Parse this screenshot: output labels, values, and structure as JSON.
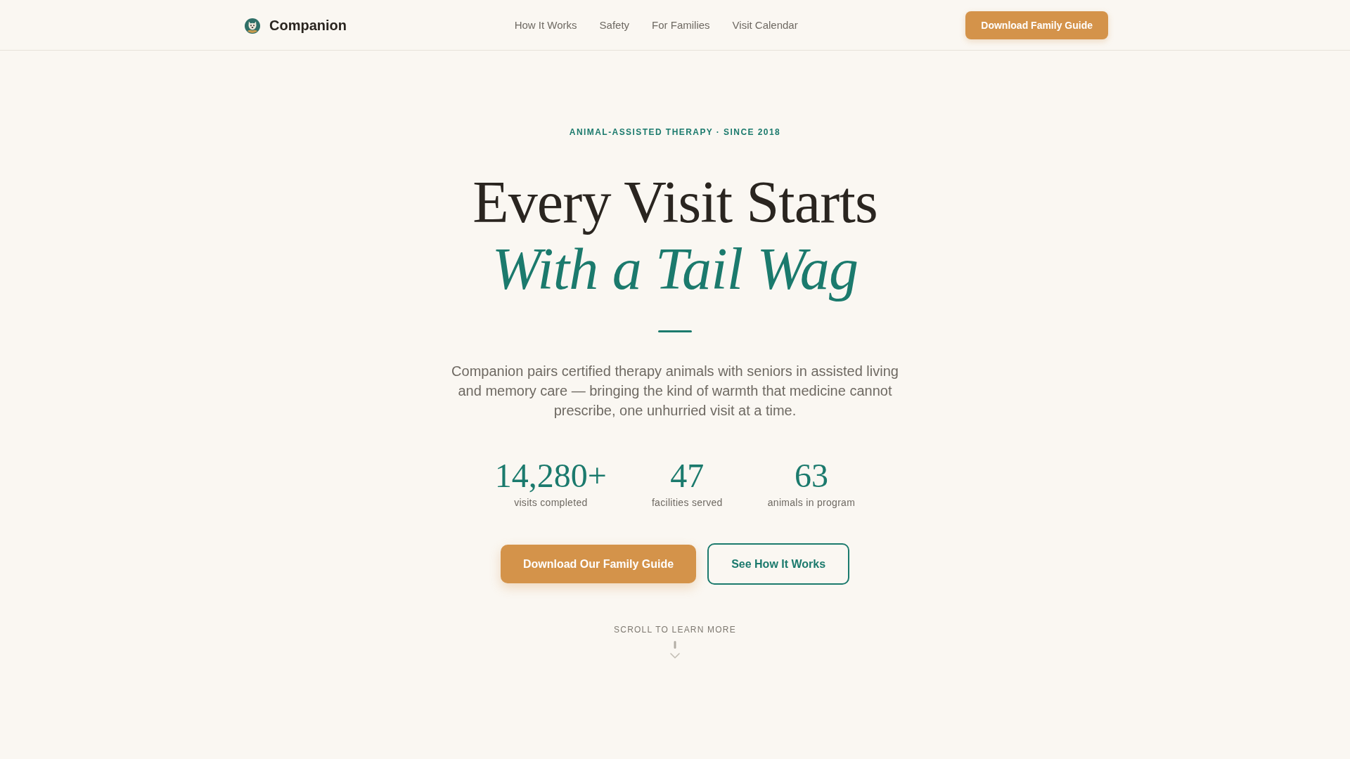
{
  "header": {
    "brand": "Companion",
    "nav": [
      {
        "label": "How It Works"
      },
      {
        "label": "Safety"
      },
      {
        "label": "For Families"
      },
      {
        "label": "Visit Calendar"
      }
    ],
    "cta": "Download Family Guide"
  },
  "hero": {
    "eyebrow": "ANIMAL-ASSISTED THERAPY · SINCE 2018",
    "headline": "Every Visit Starts",
    "headline_accent": "With a Tail Wag",
    "description": "Companion pairs certified therapy animals with seniors in assisted living and memory care — bringing the kind of warmth that medicine cannot prescribe, one unhurried visit at a time.",
    "stats": [
      {
        "value": "14,280+",
        "label": "visits completed"
      },
      {
        "value": "47",
        "label": "facilities served"
      },
      {
        "value": "63",
        "label": "animals in program"
      }
    ],
    "buttons": [
      {
        "label": "Download Our Family Guide",
        "kind": "primary"
      },
      {
        "label": "See How It Works",
        "kind": "outline"
      }
    ],
    "scroll_hint": "SCROLL TO LEARN MORE"
  }
}
